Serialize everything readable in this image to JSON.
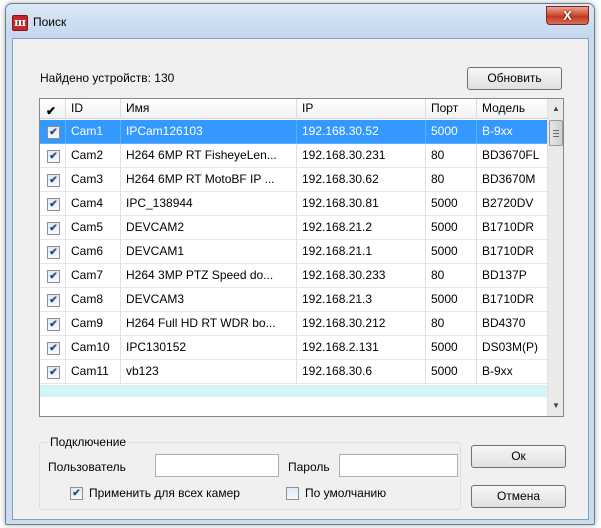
{
  "window": {
    "title": "Поиск",
    "close_glyph": "X"
  },
  "found": {
    "label": "Найдено устройств: 130"
  },
  "buttons": {
    "refresh": "Обновить",
    "ok": "Ок",
    "cancel": "Отмена"
  },
  "table": {
    "columns": [
      "ID",
      "Имя",
      "IP",
      "Порт",
      "Модель"
    ],
    "rows": [
      {
        "checked": true,
        "id": "Cam1",
        "name": "IPCam126103",
        "ip": "192.168.30.52",
        "port": "5000",
        "model": "B-9xx"
      },
      {
        "checked": true,
        "id": "Cam2",
        "name": "H264 6MP RT FisheyeLen...",
        "ip": "192.168.30.231",
        "port": "80",
        "model": "BD3670FL"
      },
      {
        "checked": true,
        "id": "Cam3",
        "name": "H264 6MP RT MotoBF IP ...",
        "ip": "192.168.30.62",
        "port": "80",
        "model": "BD3670M"
      },
      {
        "checked": true,
        "id": "Cam4",
        "name": "IPC_138944",
        "ip": "192.168.30.81",
        "port": "5000",
        "model": "B2720DV"
      },
      {
        "checked": true,
        "id": "Cam5",
        "name": "DEVCAM2",
        "ip": "192.168.21.2",
        "port": "5000",
        "model": "B1710DR"
      },
      {
        "checked": true,
        "id": "Cam6",
        "name": "DEVCAM1",
        "ip": "192.168.21.1",
        "port": "5000",
        "model": "B1710DR"
      },
      {
        "checked": true,
        "id": "Cam7",
        "name": "H264 3MP PTZ Speed do...",
        "ip": "192.168.30.233",
        "port": "80",
        "model": "BD137P"
      },
      {
        "checked": true,
        "id": "Cam8",
        "name": "DEVCAM3",
        "ip": "192.168.21.3",
        "port": "5000",
        "model": "B1710DR"
      },
      {
        "checked": true,
        "id": "Cam9",
        "name": "H264 Full HD RT WDR bo...",
        "ip": "192.168.30.212",
        "port": "80",
        "model": "BD4370"
      },
      {
        "checked": true,
        "id": "Cam10",
        "name": "IPC130152",
        "ip": "192.168.2.131",
        "port": "5000",
        "model": "DS03M(P)"
      },
      {
        "checked": true,
        "id": "Cam11",
        "name": "vb123",
        "ip": "192.168.30.6",
        "port": "5000",
        "model": "B-9xx"
      }
    ],
    "selected_row": 0
  },
  "connection": {
    "group_title": "Подключение",
    "user_label": "Пользователь",
    "user_value": "",
    "password_label": "Пароль",
    "password_value": "",
    "apply_all_label": "Применить для всех камер",
    "apply_all_checked": true,
    "default_label": "По умолчанию",
    "default_checked": false
  },
  "colors": {
    "selection": "#3399ff",
    "close_button": "#c03a24",
    "app_icon": "#c0292b"
  }
}
